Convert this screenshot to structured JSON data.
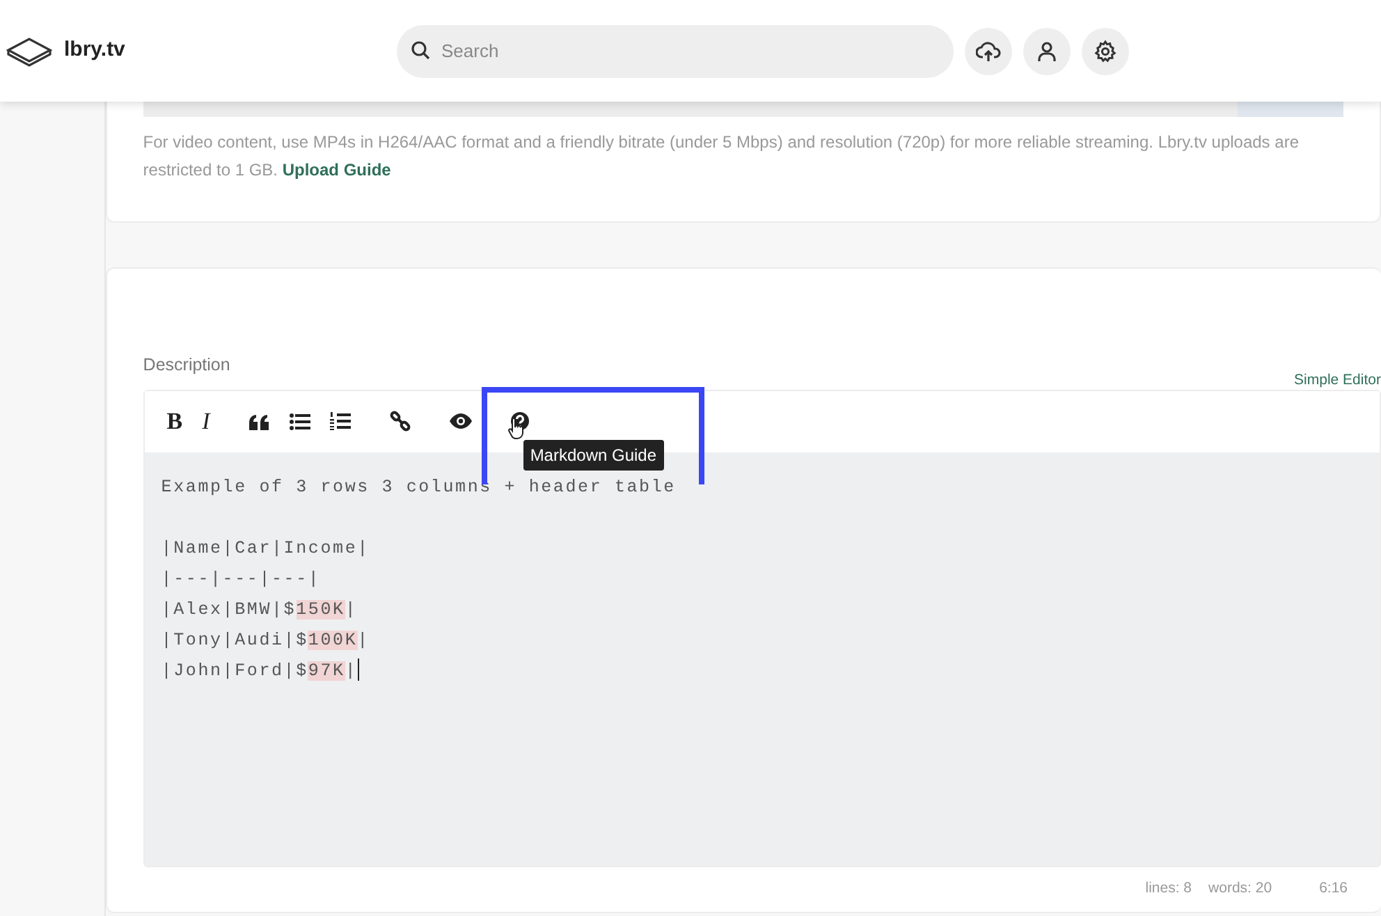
{
  "header": {
    "logo_text": "lbry.tv",
    "search": {
      "placeholder": "Search"
    }
  },
  "upload_card": {
    "note": "For video content, use MP4s in H264/AAC format and a friendly bitrate (under 5 Mbps) and resolution (720p) for more reliable streaming. Lbry.tv uploads are restricted to 1 GB.",
    "link": "Upload Guide"
  },
  "description": {
    "label": "Description",
    "mode_link": "Simple Editor",
    "toolbar": [
      {
        "kind": "bold",
        "label": "B"
      },
      {
        "kind": "italic",
        "label": "I"
      },
      {
        "kind": "quote"
      },
      {
        "kind": "ul"
      },
      {
        "kind": "ol"
      },
      {
        "kind": "link"
      },
      {
        "kind": "preview"
      },
      {
        "kind": "guide",
        "hovered": true
      }
    ],
    "tooltip": "Markdown Guide",
    "paragraphs": [
      {
        "lines": [
          {
            "cursor": false,
            "segments": [
              {
                "text": "Example of 3 rows 3 columns + header table",
                "highlight": false
              }
            ]
          }
        ]
      },
      {
        "lines": [
          {
            "cursor": false,
            "segments": [
              {
                "text": "|Name|Car|Income|",
                "highlight": false
              }
            ]
          },
          {
            "cursor": false,
            "segments": [
              {
                "text": "|---|---|---|",
                "highlight": false
              }
            ]
          },
          {
            "cursor": false,
            "segments": [
              {
                "text": "|Alex|BMW|$",
                "highlight": false
              },
              {
                "text": "150K",
                "highlight": true
              },
              {
                "text": "|",
                "highlight": false
              }
            ]
          },
          {
            "cursor": false,
            "segments": [
              {
                "text": "|Tony|Audi|$",
                "highlight": false
              },
              {
                "text": "100K",
                "highlight": true
              },
              {
                "text": "|",
                "highlight": false
              }
            ]
          },
          {
            "cursor": true,
            "segments": [
              {
                "text": "|John|Ford|$",
                "highlight": false
              },
              {
                "text": "97K",
                "highlight": true
              },
              {
                "text": "|",
                "highlight": false
              }
            ]
          }
        ]
      }
    ],
    "status": {
      "lines": "lines: 8",
      "words": "words: 20",
      "position": "6:16"
    }
  }
}
